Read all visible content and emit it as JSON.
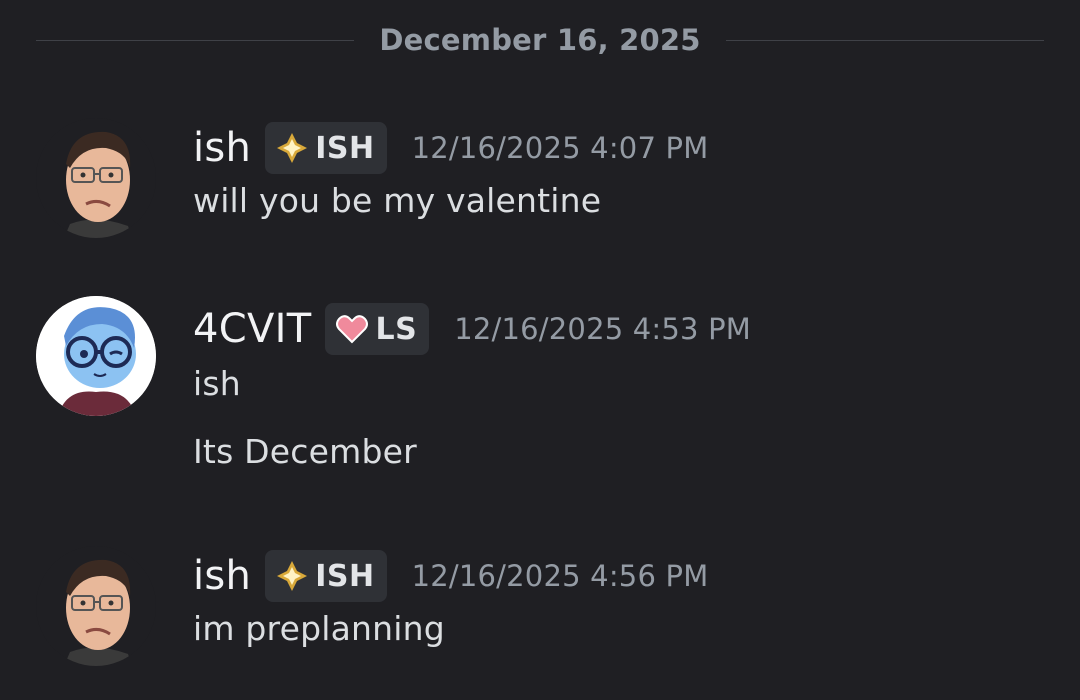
{
  "divider": {
    "date": "December 16, 2025"
  },
  "messages": [
    {
      "username": "ish",
      "tag": "ISH",
      "tag_icon": "sparkle-diamond-icon",
      "timestamp": "12/16/2025 4:07 PM",
      "lines": [
        "will you be my valentine"
      ]
    },
    {
      "username": "4CVIT",
      "tag": "LS",
      "tag_icon": "heart-icon",
      "timestamp": "12/16/2025 4:53 PM",
      "lines": [
        "ish",
        "Its December"
      ]
    },
    {
      "username": "ish",
      "tag": "ISH",
      "tag_icon": "sparkle-diamond-icon",
      "timestamp": "12/16/2025 4:56 PM",
      "lines": [
        "im preplanning"
      ]
    }
  ],
  "colors": {
    "background": "#1f1f23",
    "username": "#f2f3f5",
    "muted": "#949ba4",
    "message_text": "#dbdee1",
    "tag_bg": "#2f3136",
    "heart": "#f08a9c",
    "diamond": "#d9a93a"
  }
}
